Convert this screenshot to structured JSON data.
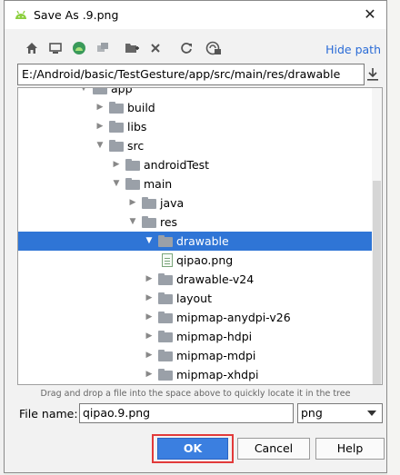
{
  "window": {
    "title": "Save As .9.png"
  },
  "toolbar": {
    "hide_path_label": "Hide path"
  },
  "path": {
    "value": "E:/Android/basic/TestGesture/app/src/main/res/drawable"
  },
  "tree": {
    "items": [
      {
        "label": "app",
        "depth": 0,
        "kind": "folder",
        "expanded": true
      },
      {
        "label": "build",
        "depth": 1,
        "kind": "folder",
        "expanded": false
      },
      {
        "label": "libs",
        "depth": 1,
        "kind": "folder",
        "expanded": false
      },
      {
        "label": "src",
        "depth": 1,
        "kind": "folder",
        "expanded": true
      },
      {
        "label": "androidTest",
        "depth": 2,
        "kind": "folder",
        "expanded": false
      },
      {
        "label": "main",
        "depth": 2,
        "kind": "folder",
        "expanded": true
      },
      {
        "label": "java",
        "depth": 3,
        "kind": "folder",
        "expanded": false
      },
      {
        "label": "res",
        "depth": 3,
        "kind": "folder",
        "expanded": true
      },
      {
        "label": "drawable",
        "depth": 4,
        "kind": "folder",
        "expanded": true,
        "selected": true
      },
      {
        "label": "qipao.png",
        "depth": 5,
        "kind": "file"
      },
      {
        "label": "drawable-v24",
        "depth": 4,
        "kind": "folder",
        "expanded": false
      },
      {
        "label": "layout",
        "depth": 4,
        "kind": "folder",
        "expanded": false
      },
      {
        "label": "mipmap-anydpi-v26",
        "depth": 4,
        "kind": "folder",
        "expanded": false
      },
      {
        "label": "mipmap-hdpi",
        "depth": 4,
        "kind": "folder",
        "expanded": false
      },
      {
        "label": "mipmap-mdpi",
        "depth": 4,
        "kind": "folder",
        "expanded": false
      },
      {
        "label": "mipmap-xhdpi",
        "depth": 4,
        "kind": "folder",
        "expanded": false
      }
    ]
  },
  "hint": "Drag and drop a file into the space above to quickly locate it in the tree",
  "file_name": {
    "label": "File name:",
    "value": "qipao.9.png"
  },
  "file_type": {
    "value": "png"
  },
  "buttons": {
    "ok": "OK",
    "cancel": "Cancel",
    "help": "Help"
  },
  "colors": {
    "selection": "#2f75d6",
    "accent": "#3b7fe0",
    "highlight_border": "#e23a3a",
    "link": "#2a6bd6"
  }
}
